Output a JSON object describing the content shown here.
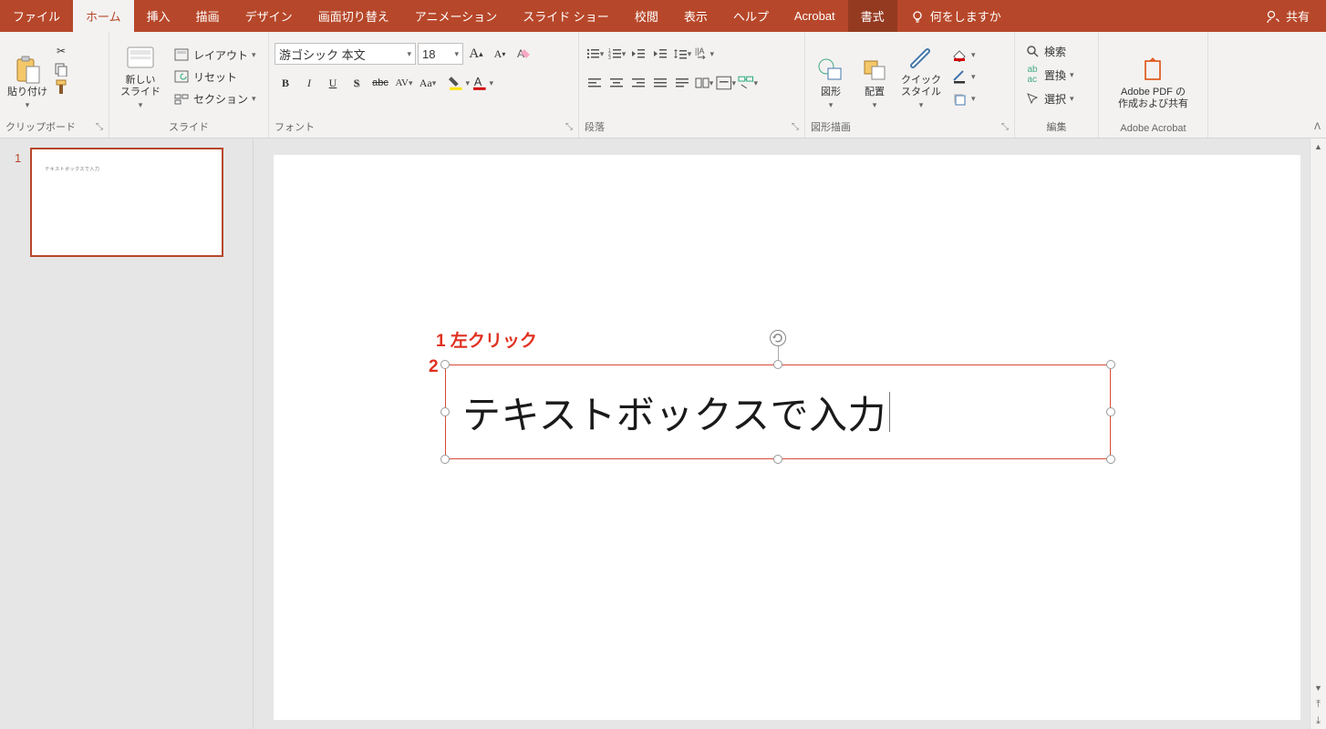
{
  "tabs": {
    "file": "ファイル",
    "home": "ホーム",
    "insert": "挿入",
    "draw": "描画",
    "design": "デザイン",
    "transitions": "画面切り替え",
    "animations": "アニメーション",
    "slideshow": "スライド ショー",
    "review": "校閲",
    "view": "表示",
    "help": "ヘルプ",
    "acrobat": "Acrobat",
    "format": "書式"
  },
  "tellme": "何をしますか",
  "share": "共有",
  "groups": {
    "clipboard": {
      "title": "クリップボード",
      "paste": "貼り付け"
    },
    "slides": {
      "title": "スライド",
      "new_slide": "新しい\nスライド",
      "layout": "レイアウト",
      "reset": "リセット",
      "section": "セクション"
    },
    "font": {
      "title": "フォント",
      "font_name": "游ゴシック 本文",
      "font_size": "18"
    },
    "paragraph": {
      "title": "段落"
    },
    "drawing": {
      "title": "図形描画",
      "shapes": "図形",
      "arrange": "配置",
      "quickstyle": "クイック\nスタイル"
    },
    "editing": {
      "title": "編集",
      "find": "検索",
      "replace": "置換",
      "select": "選択"
    },
    "acrobat": {
      "title": "Adobe Acrobat",
      "create": "Adobe PDF の\n作成および共有"
    }
  },
  "slide_panel": {
    "thumbs": [
      {
        "num": "1"
      }
    ]
  },
  "slide": {
    "annotation1_num": "1",
    "annotation1_text": "左クリック",
    "annotation2_num": "2",
    "textbox_text": "テキストボックスで入力"
  }
}
